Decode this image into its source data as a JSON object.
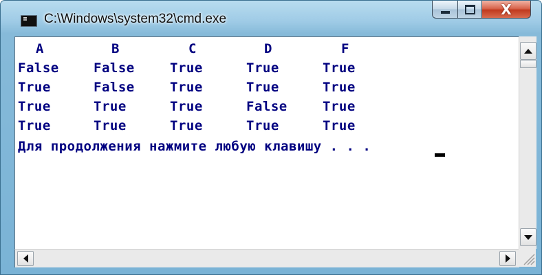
{
  "window": {
    "title": "C:\\Windows\\system32\\cmd.exe",
    "icon": "console-app-icon",
    "controls": {
      "minimize": "minimize-icon",
      "maximize": "maximize-icon",
      "close_glyph": "X"
    }
  },
  "console": {
    "text_color": "#000080",
    "background": "#ffffff",
    "header": [
      "A",
      "B",
      "C",
      "D",
      "F"
    ],
    "rows": [
      [
        "False",
        "False",
        "True",
        "True",
        "True"
      ],
      [
        "True",
        "False",
        "True",
        "True",
        "True"
      ],
      [
        "True",
        "True",
        "True",
        "False",
        "True"
      ],
      [
        "True",
        "True",
        "True",
        "True",
        "True"
      ]
    ],
    "prompt": "Для продолжения нажмите любую клавишу . . ."
  }
}
